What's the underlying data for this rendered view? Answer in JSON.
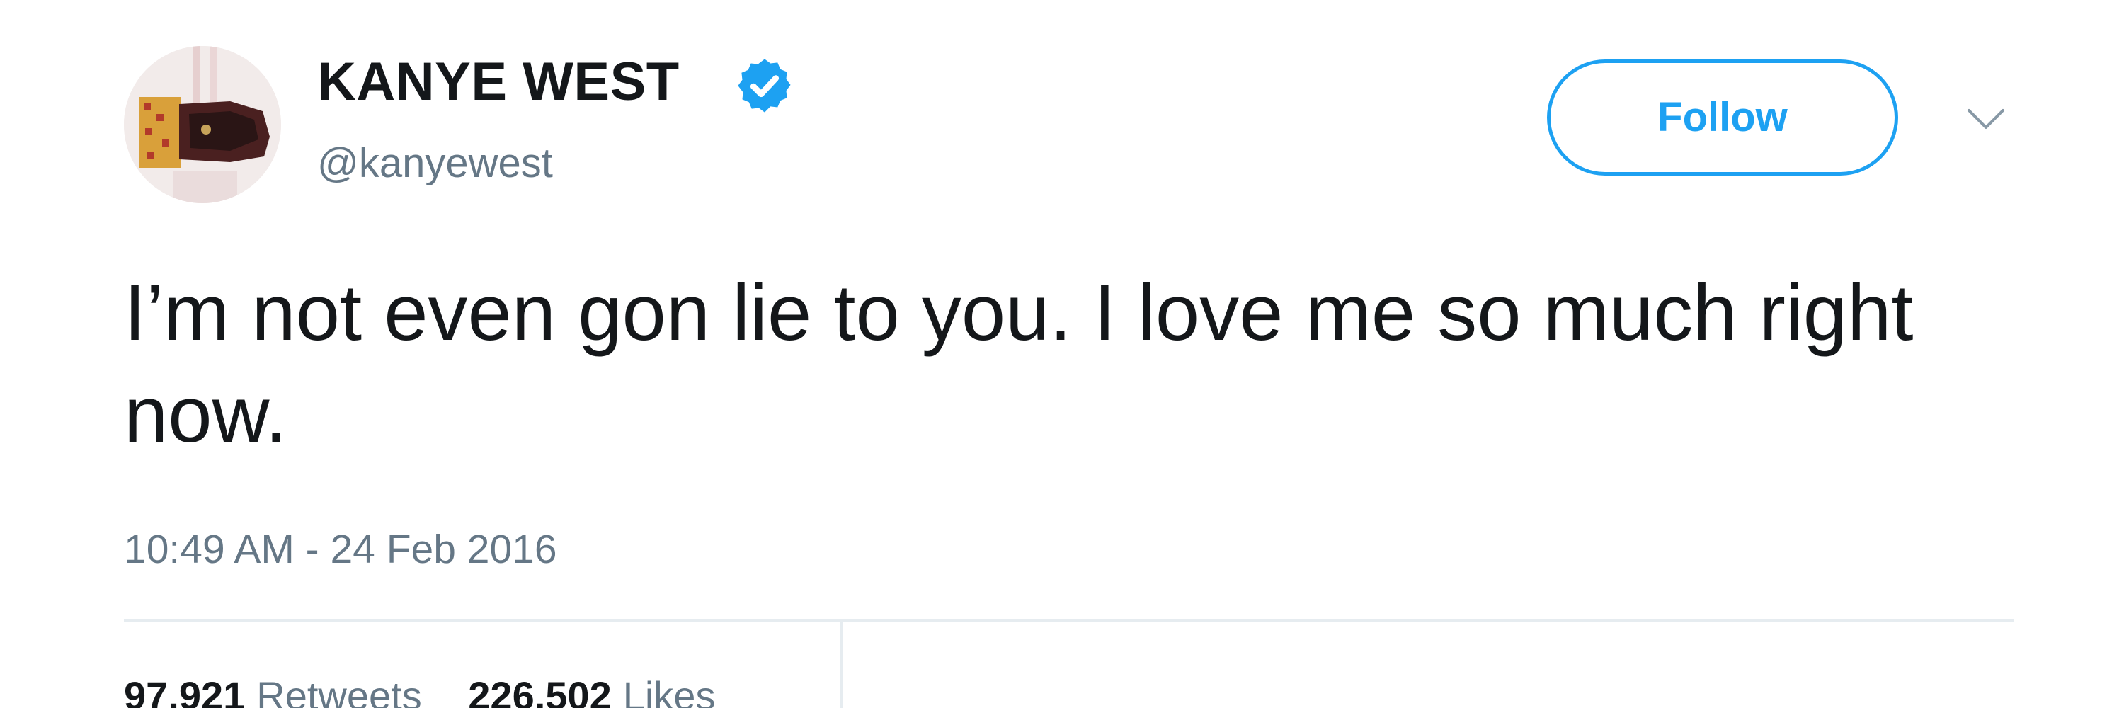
{
  "user": {
    "display_name": "KANYE WEST",
    "handle": "@kanyewest",
    "verified": true,
    "avatar_icon": "profile-photo"
  },
  "actions": {
    "follow_label": "Follow",
    "menu_icon": "chevron-down-icon"
  },
  "tweet": {
    "text": "I’m not even gon lie to you. I love me so much right now.",
    "timestamp": "10:49 AM - 24 Feb 2016"
  },
  "stats": {
    "retweets_count": "97,921",
    "retweets_label": "Retweets",
    "likes_count": "226,502",
    "likes_label": "Likes"
  },
  "colors": {
    "accent": "#1da1f2",
    "text": "#14171a",
    "secondary_text": "#657786",
    "divider": "#e6ecf0"
  }
}
